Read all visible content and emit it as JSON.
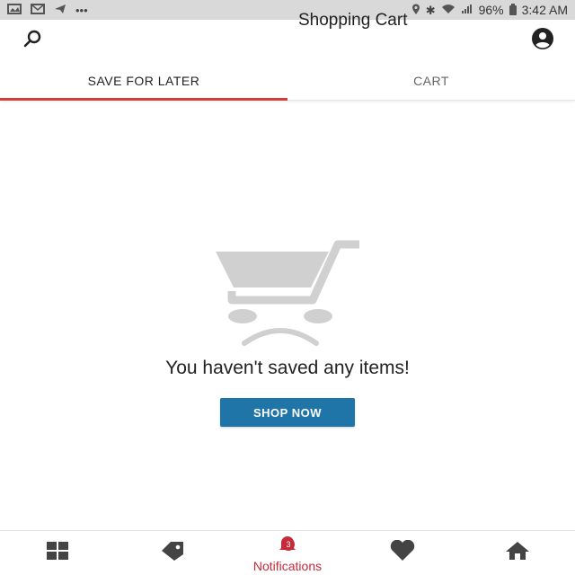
{
  "status_bar": {
    "time": "3:42 AM",
    "battery": "96%"
  },
  "header": {
    "title": "Shopping Cart"
  },
  "tabs": [
    {
      "label": "SAVE FOR LATER",
      "active": true
    },
    {
      "label": "CART",
      "active": false
    }
  ],
  "empty_state": {
    "message": "You haven't saved any items!",
    "button_label": "SHOP NOW"
  },
  "bottom_nav": {
    "notifications_label": "Notifications",
    "notifications_count": "3"
  },
  "colors": {
    "accent": "#d33a3a",
    "primary_button": "#1f74a8",
    "illustration": "#d0d0d0"
  }
}
